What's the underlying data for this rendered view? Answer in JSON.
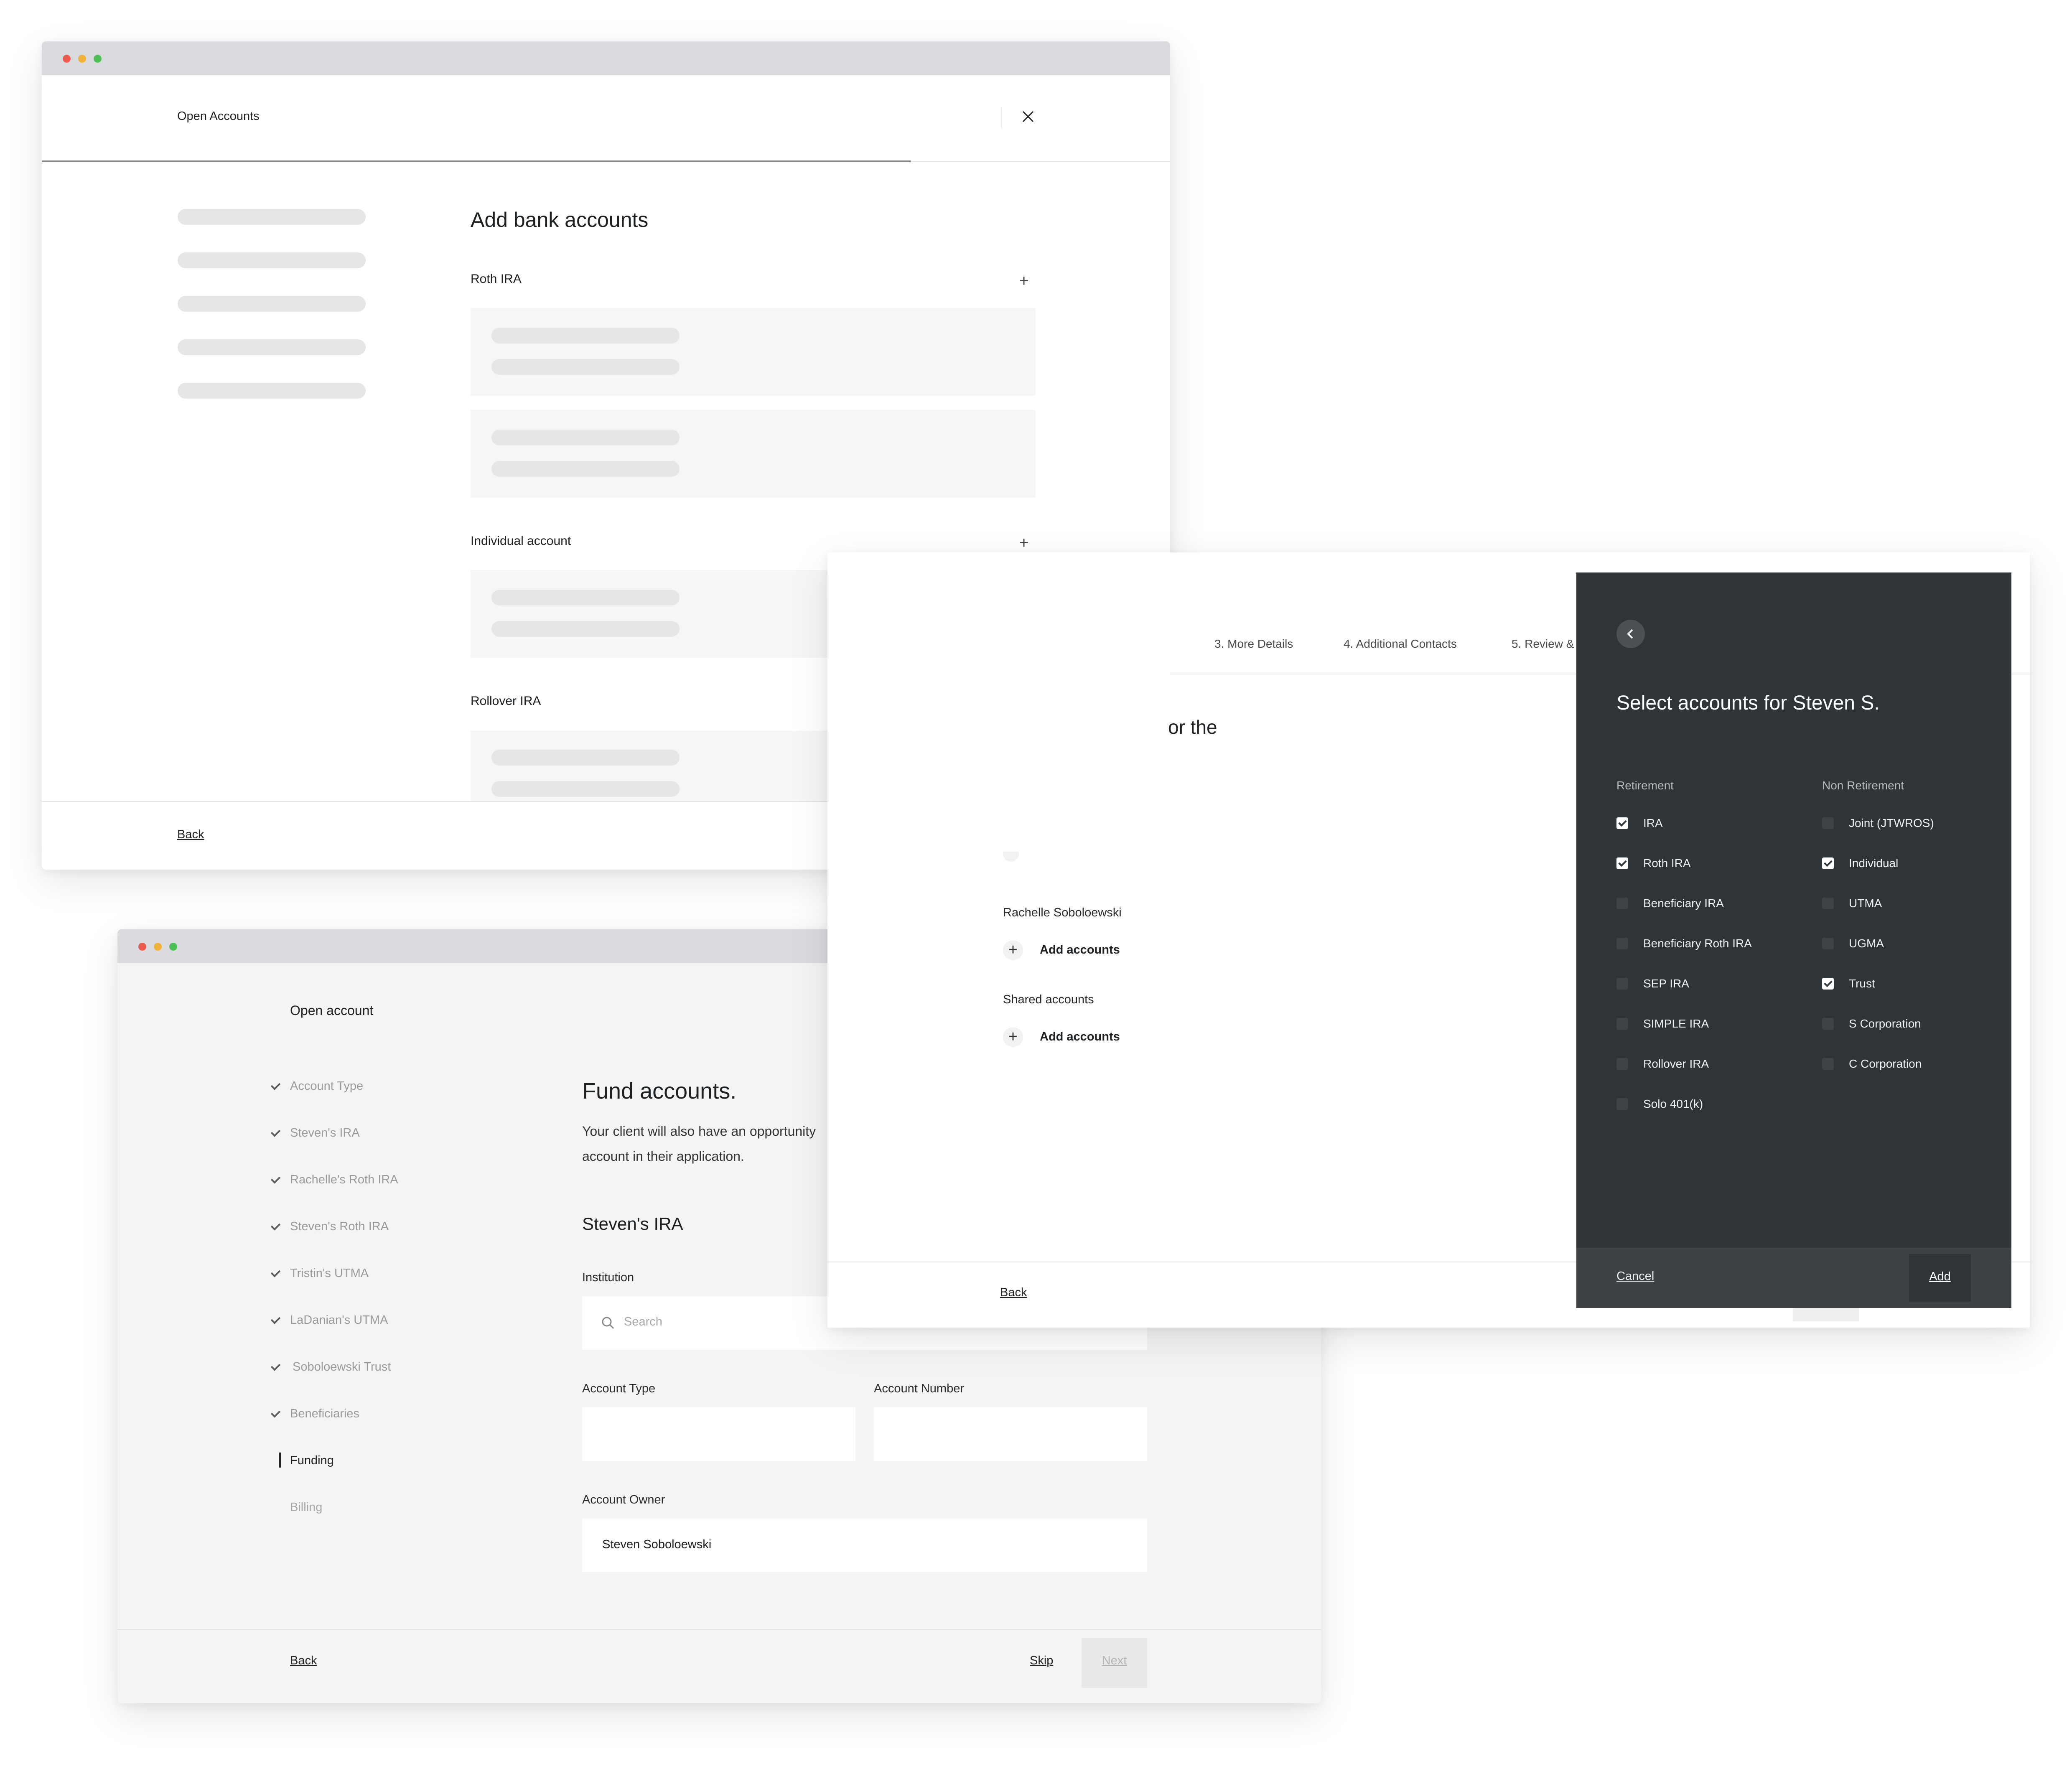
{
  "window1": {
    "title": "Open Accounts",
    "heading": "Add bank accounts",
    "groups": [
      {
        "label": "Roth IRA"
      },
      {
        "label": "Individual account"
      },
      {
        "label": "Rollover IRA"
      }
    ],
    "back_label": "Back",
    "progress_fraction": 0.77
  },
  "window3": {
    "tabs": [
      "3. More Details",
      "4. Additional Contacts",
      "5. Review &"
    ],
    "partial_heading": "or the",
    "person_label": "Rachelle Soboloewski",
    "add_accounts_label": "Add accounts",
    "shared_label": "Shared accounts",
    "add_accounts_label2": "Add accounts",
    "back_label": "Back",
    "panel": {
      "title": "Select accounts for Steven S.",
      "retirement_header": "Retirement",
      "non_retirement_header": "Non Retirement",
      "retirement": [
        {
          "label": "IRA",
          "checked": true
        },
        {
          "label": "Roth IRA",
          "checked": true
        },
        {
          "label": "Beneficiary IRA",
          "checked": false
        },
        {
          "label": "Beneficiary Roth IRA",
          "checked": false
        },
        {
          "label": "SEP IRA",
          "checked": false
        },
        {
          "label": "SIMPLE IRA",
          "checked": false
        },
        {
          "label": "Rollover IRA",
          "checked": false
        },
        {
          "label": "Solo 401(k)",
          "checked": false
        }
      ],
      "non_retirement": [
        {
          "label": "Joint (JTWROS)",
          "checked": false
        },
        {
          "label": "Individual",
          "checked": true
        },
        {
          "label": "UTMA",
          "checked": false
        },
        {
          "label": "UGMA",
          "checked": false
        },
        {
          "label": "Trust",
          "checked": true
        },
        {
          "label": "S Corporation",
          "checked": false
        },
        {
          "label": "C Corporation",
          "checked": false
        }
      ],
      "cancel_label": "Cancel",
      "add_label": "Add"
    }
  },
  "window2": {
    "title": "Open account",
    "steps": [
      {
        "label": "Account Type",
        "done": true
      },
      {
        "label": "Steven's IRA",
        "done": true
      },
      {
        "label": "Rachelle's Roth IRA",
        "done": true
      },
      {
        "label": "Steven's Roth IRA",
        "done": true
      },
      {
        "label": "Tristin's UTMA",
        "done": true
      },
      {
        "label": "LaDanian's UTMA",
        "done": true
      },
      {
        "label": "Soboloewski Trust",
        "done": true
      },
      {
        "label": "Beneficiaries",
        "done": true
      },
      {
        "label": "Funding",
        "done": false,
        "current": true
      },
      {
        "label": "Billing",
        "done": false
      }
    ],
    "heading": "Fund accounts.",
    "desc_line1": "Your client will also have an opportunity",
    "desc_line2": "account in their application.",
    "section_title": "Steven's IRA",
    "institution_label": "Institution",
    "search_placeholder": "Search",
    "account_type_label": "Account Type",
    "account_number_label": "Account Number",
    "account_owner_label": "Account Owner",
    "account_owner_value": "Steven Soboloewski",
    "back_label": "Back",
    "skip_label": "Skip",
    "next_label": "Next"
  },
  "colors": {
    "chrome": "#dadbdf",
    "dot_red": "#ef5a4f",
    "dot_yellow": "#f0b23a",
    "dot_green": "#4cbf55",
    "panel_dark": "#2f3438",
    "panel_footer": "#3c4246"
  },
  "icons": [
    "close-icon",
    "plus-icon",
    "chevron-left-icon",
    "search-icon",
    "checkmark-icon"
  ]
}
